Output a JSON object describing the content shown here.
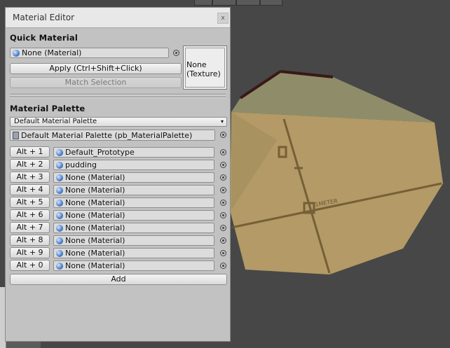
{
  "window": {
    "title": "Material Editor",
    "close_glyph": "x"
  },
  "quick_material": {
    "heading": "Quick Material",
    "material_value": "None (Material)",
    "apply_label": "Apply (Ctrl+Shift+Click)",
    "match_label": "Match Selection",
    "texture_line1": "None",
    "texture_line2": "(Texture)"
  },
  "material_palette": {
    "heading": "Material Palette",
    "dropdown_value": "Default Material Palette",
    "palette_asset": "Default Material Palette (pb_MaterialPalette)",
    "rows": [
      {
        "shortcut": "Alt + 1",
        "material": "Default_Prototype"
      },
      {
        "shortcut": "Alt + 2",
        "material": "pudding"
      },
      {
        "shortcut": "Alt + 3",
        "material": "None (Material)"
      },
      {
        "shortcut": "Alt + 4",
        "material": "None (Material)"
      },
      {
        "shortcut": "Alt + 5",
        "material": "None (Material)"
      },
      {
        "shortcut": "Alt + 6",
        "material": "None (Material)"
      },
      {
        "shortcut": "Alt + 7",
        "material": "None (Material)"
      },
      {
        "shortcut": "Alt + 8",
        "material": "None (Material)"
      },
      {
        "shortcut": "Alt + 9",
        "material": "None (Material)"
      },
      {
        "shortcut": "Alt + 0",
        "material": "None (Material)"
      }
    ],
    "add_label": "Add"
  },
  "scene": {
    "gizmo_text": "1METER"
  },
  "colors": {
    "background": "#474747",
    "mesh_top": "#8f8d69",
    "mesh_front": "#b39a66"
  }
}
